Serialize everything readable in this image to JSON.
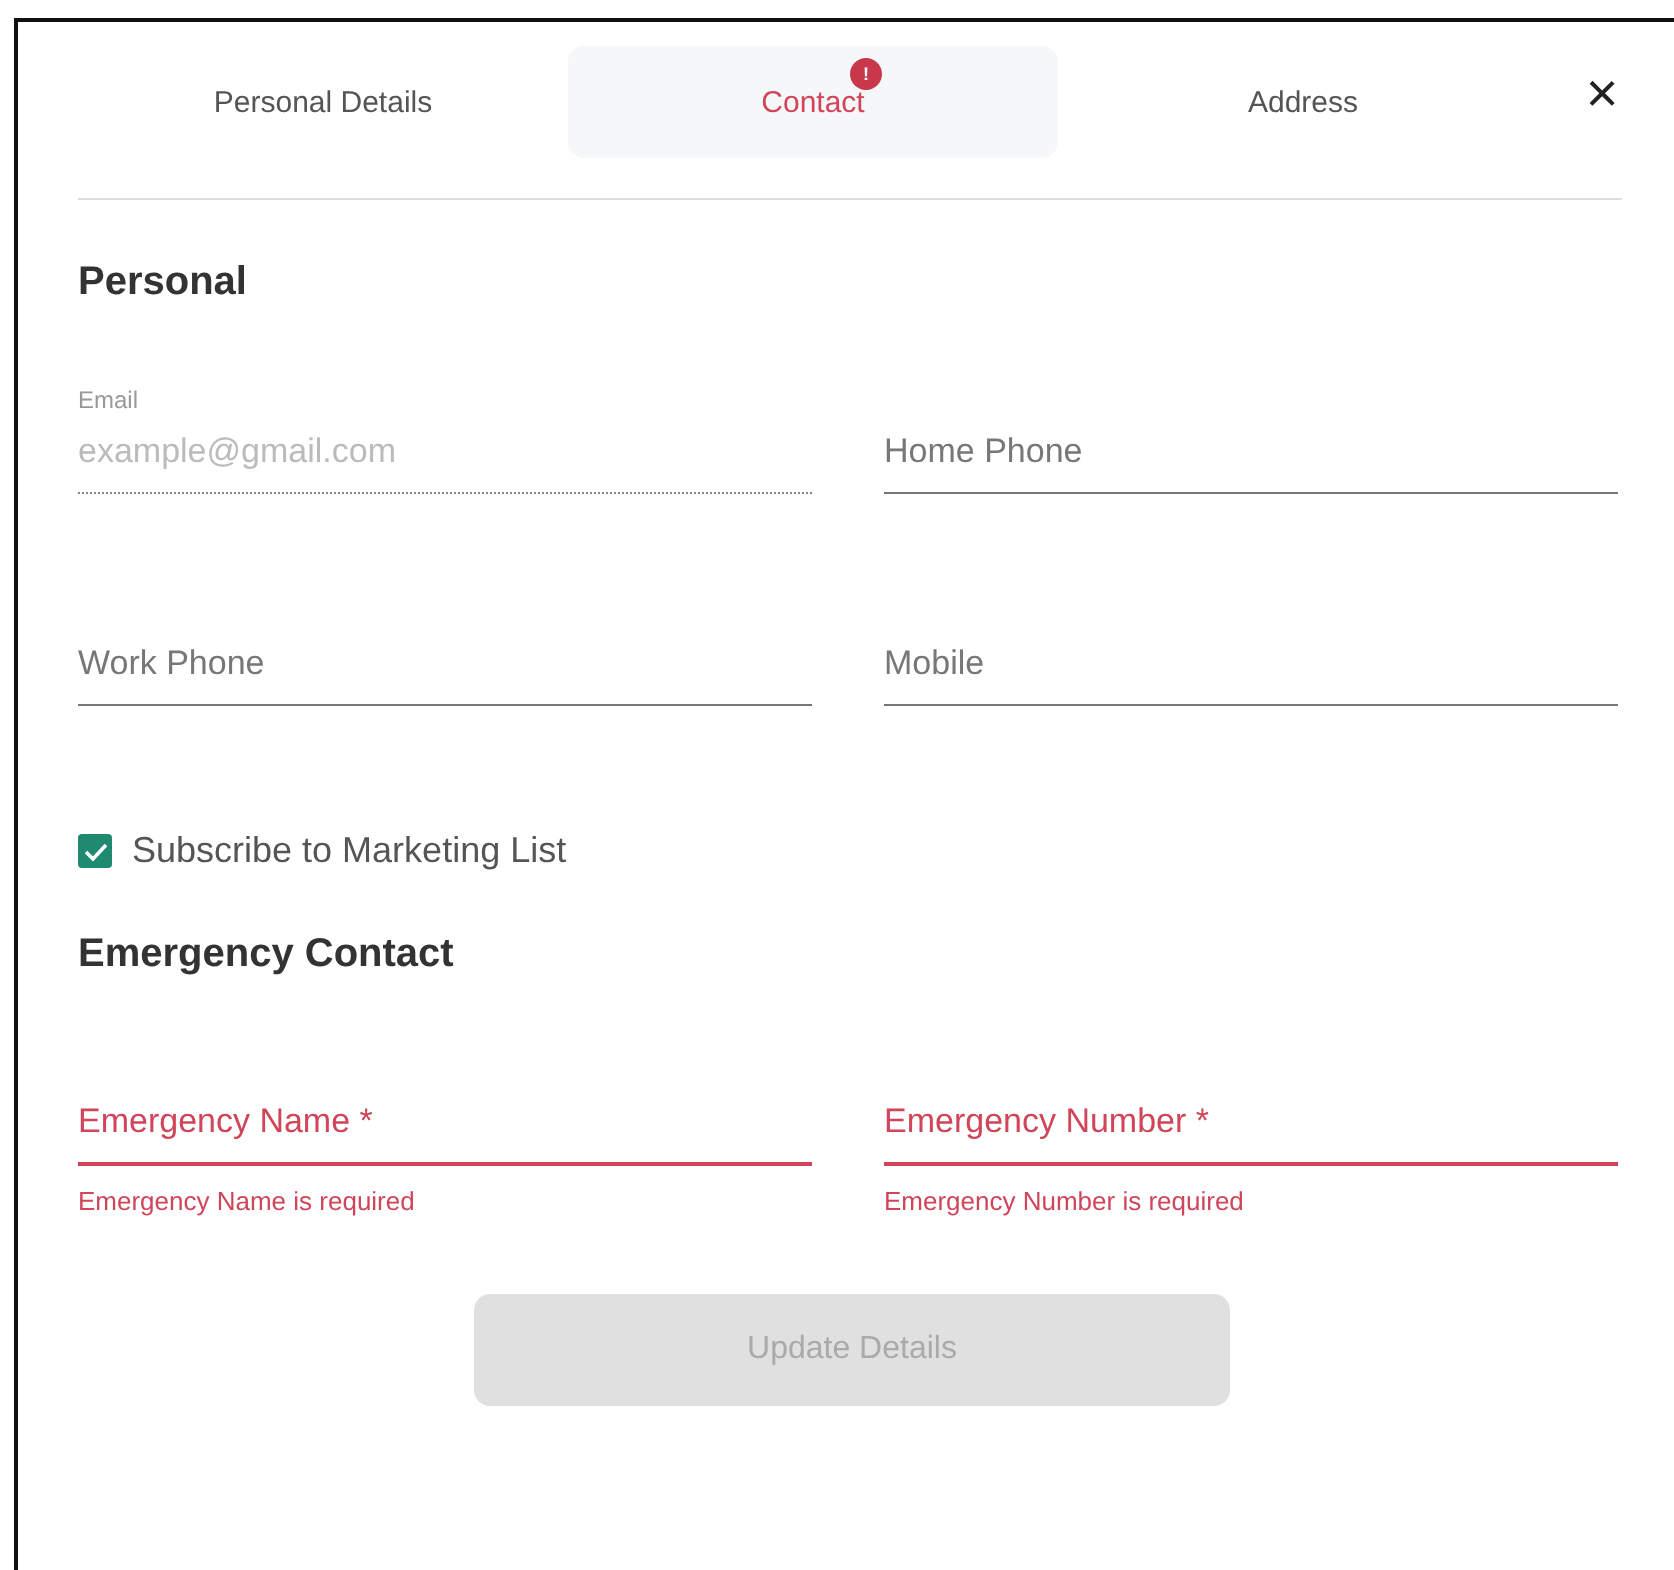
{
  "tabs": [
    {
      "label": "Personal Details",
      "selected": false
    },
    {
      "label": "Contact",
      "selected": true,
      "badge": "!"
    },
    {
      "label": "Address",
      "selected": false
    }
  ],
  "close_button": {
    "label": "×"
  },
  "sections": [
    {
      "title": "Personal",
      "fields": [
        {
          "label": "Email",
          "placeholder": "example@gmail.com",
          "disabled": true,
          "error": false
        },
        {
          "placeholder": "Home Phone",
          "disabled": false,
          "error": false
        },
        {
          "placeholder": "Work Phone",
          "disabled": false,
          "error": false
        },
        {
          "placeholder": "Mobile",
          "disabled": false,
          "error": false
        }
      ],
      "checkbox": {
        "label": "Subscribe to Marketing List",
        "checked": true
      }
    },
    {
      "title": "Emergency Contact",
      "fields": [
        {
          "placeholder": "Emergency Name *",
          "disabled": false,
          "error": true,
          "error_text": "Emergency Name is required"
        },
        {
          "placeholder": "Emergency Number *",
          "disabled": false,
          "error": true,
          "error_text": "Emergency Number is required"
        }
      ]
    }
  ],
  "submit_button": {
    "label": "Update Details",
    "disabled": true
  }
}
